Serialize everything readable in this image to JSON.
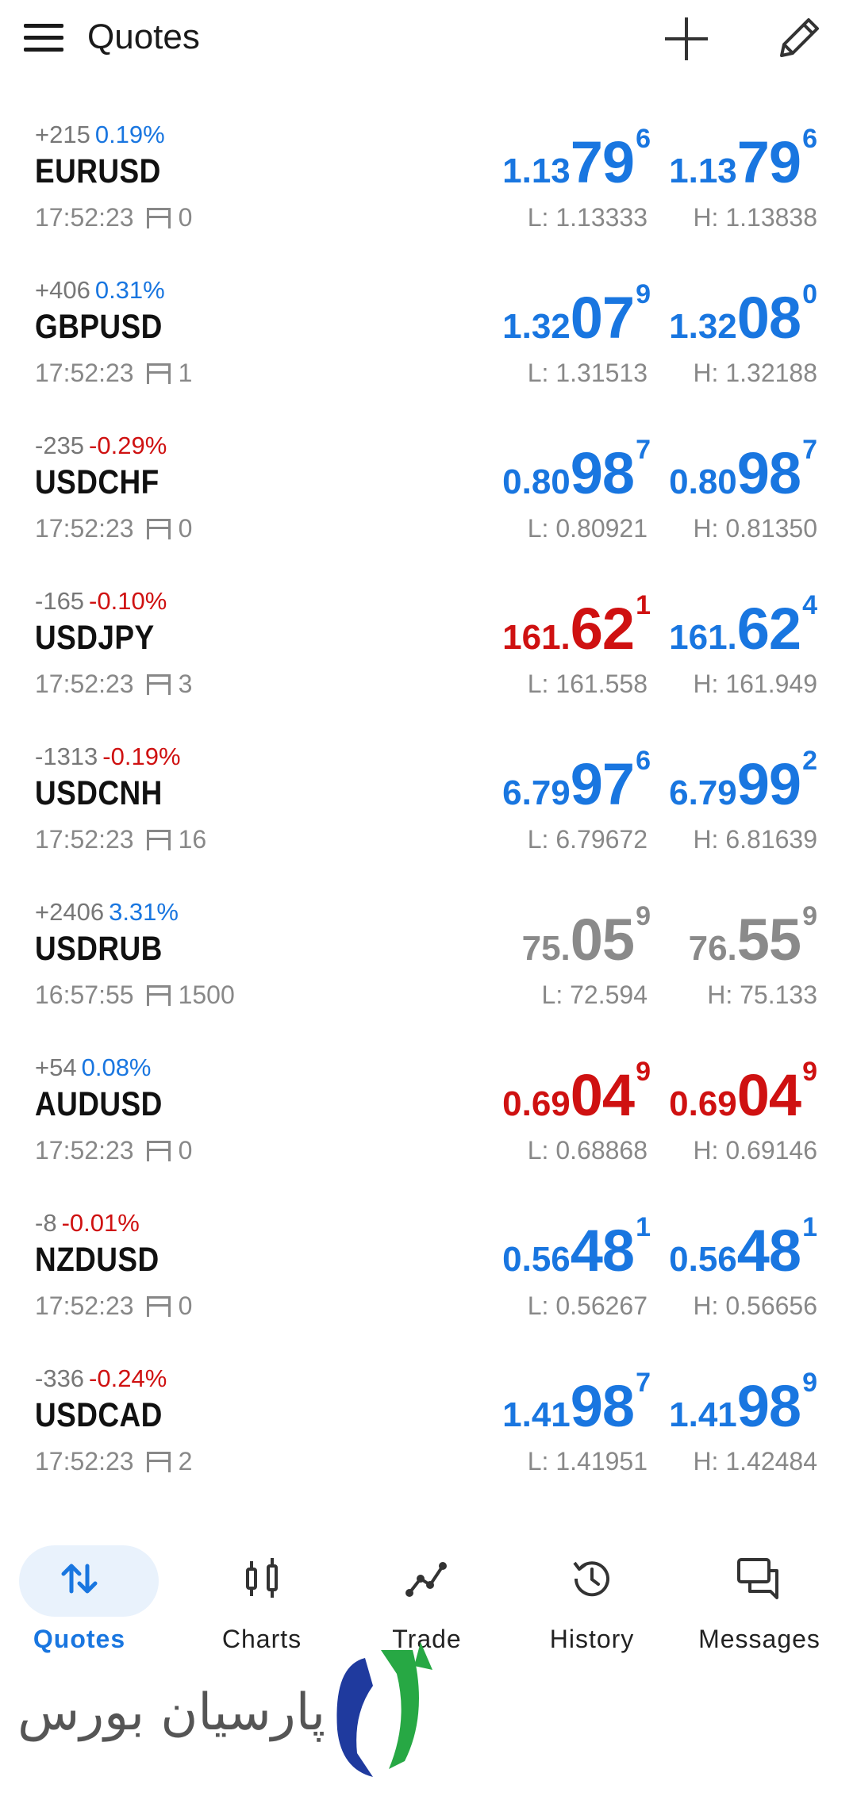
{
  "header": {
    "title": "Quotes",
    "icons": [
      "menu-icon",
      "add-icon",
      "edit-icon"
    ]
  },
  "colors": {
    "blue": "#1976e0",
    "red": "#cf1111",
    "gray": "#8a8a8a",
    "muted": "#888888"
  },
  "quotes": [
    {
      "change": "+215",
      "pct": "0.19%",
      "pct_color": "blue",
      "symbol": "EURUSD",
      "time": "17:52:23",
      "spread": "0",
      "bid": {
        "small": "1.13",
        "big": "79",
        "sup": "6",
        "color": "blue"
      },
      "ask": {
        "small": "1.13",
        "big": "79",
        "sup": "6",
        "color": "blue"
      },
      "low": "L: 1.13333",
      "high": "H: 1.13838"
    },
    {
      "change": "+406",
      "pct": "0.31%",
      "pct_color": "blue",
      "symbol": "GBPUSD",
      "time": "17:52:23",
      "spread": "1",
      "bid": {
        "small": "1.32",
        "big": "07",
        "sup": "9",
        "color": "blue"
      },
      "ask": {
        "small": "1.32",
        "big": "08",
        "sup": "0",
        "color": "blue"
      },
      "low": "L: 1.31513",
      "high": "H: 1.32188"
    },
    {
      "change": "-235",
      "pct": "-0.29%",
      "pct_color": "red",
      "symbol": "USDCHF",
      "time": "17:52:23",
      "spread": "0",
      "bid": {
        "small": "0.80",
        "big": "98",
        "sup": "7",
        "color": "blue"
      },
      "ask": {
        "small": "0.80",
        "big": "98",
        "sup": "7",
        "color": "blue"
      },
      "low": "L: 0.80921",
      "high": "H: 0.81350"
    },
    {
      "change": "-165",
      "pct": "-0.10%",
      "pct_color": "red",
      "symbol": "USDJPY",
      "time": "17:52:23",
      "spread": "3",
      "bid": {
        "small": "161.",
        "big": "62",
        "sup": "1",
        "color": "red"
      },
      "ask": {
        "small": "161.",
        "big": "62",
        "sup": "4",
        "color": "blue"
      },
      "low": "L: 161.558",
      "high": "H: 161.949"
    },
    {
      "change": "-1313",
      "pct": "-0.19%",
      "pct_color": "red",
      "symbol": "USDCNH",
      "time": "17:52:23",
      "spread": "16",
      "bid": {
        "small": "6.79",
        "big": "97",
        "sup": "6",
        "color": "blue"
      },
      "ask": {
        "small": "6.79",
        "big": "99",
        "sup": "2",
        "color": "blue"
      },
      "low": "L: 6.79672",
      "high": "H: 6.81639"
    },
    {
      "change": "+2406",
      "pct": "3.31%",
      "pct_color": "blue",
      "symbol": "USDRUB",
      "time": "16:57:55",
      "spread": "1500",
      "bid": {
        "small": "75.",
        "big": "05",
        "sup": "9",
        "color": "gray"
      },
      "ask": {
        "small": "76.",
        "big": "55",
        "sup": "9",
        "color": "gray"
      },
      "low": "L: 72.594",
      "high": "H: 75.133"
    },
    {
      "change": "+54",
      "pct": "0.08%",
      "pct_color": "blue",
      "symbol": "AUDUSD",
      "time": "17:52:23",
      "spread": "0",
      "bid": {
        "small": "0.69",
        "big": "04",
        "sup": "9",
        "color": "red"
      },
      "ask": {
        "small": "0.69",
        "big": "04",
        "sup": "9",
        "color": "red"
      },
      "low": "L: 0.68868",
      "high": "H: 0.69146"
    },
    {
      "change": "-8",
      "pct": "-0.01%",
      "pct_color": "red",
      "symbol": "NZDUSD",
      "time": "17:52:23",
      "spread": "0",
      "bid": {
        "small": "0.56",
        "big": "48",
        "sup": "1",
        "color": "blue"
      },
      "ask": {
        "small": "0.56",
        "big": "48",
        "sup": "1",
        "color": "blue"
      },
      "low": "L: 0.56267",
      "high": "H: 0.56656"
    },
    {
      "change": "-336",
      "pct": "-0.24%",
      "pct_color": "red",
      "symbol": "USDCAD",
      "time": "17:52:23",
      "spread": "2",
      "bid": {
        "small": "1.41",
        "big": "98",
        "sup": "7",
        "color": "blue"
      },
      "ask": {
        "small": "1.41",
        "big": "98",
        "sup": "9",
        "color": "blue"
      },
      "low": "L: 1.41951",
      "high": "H: 1.42484"
    }
  ],
  "nav": [
    {
      "label": "Quotes",
      "icon": "quotes-icon",
      "active": true
    },
    {
      "label": "Charts",
      "icon": "charts-icon",
      "active": false
    },
    {
      "label": "Trade",
      "icon": "trade-icon",
      "active": false
    },
    {
      "label": "History",
      "icon": "history-icon",
      "active": false
    },
    {
      "label": "Messages",
      "icon": "messages-icon",
      "active": false
    }
  ],
  "watermark": {
    "text": "پارسیان بورس",
    "icon": "parsian-bourse-logo"
  }
}
